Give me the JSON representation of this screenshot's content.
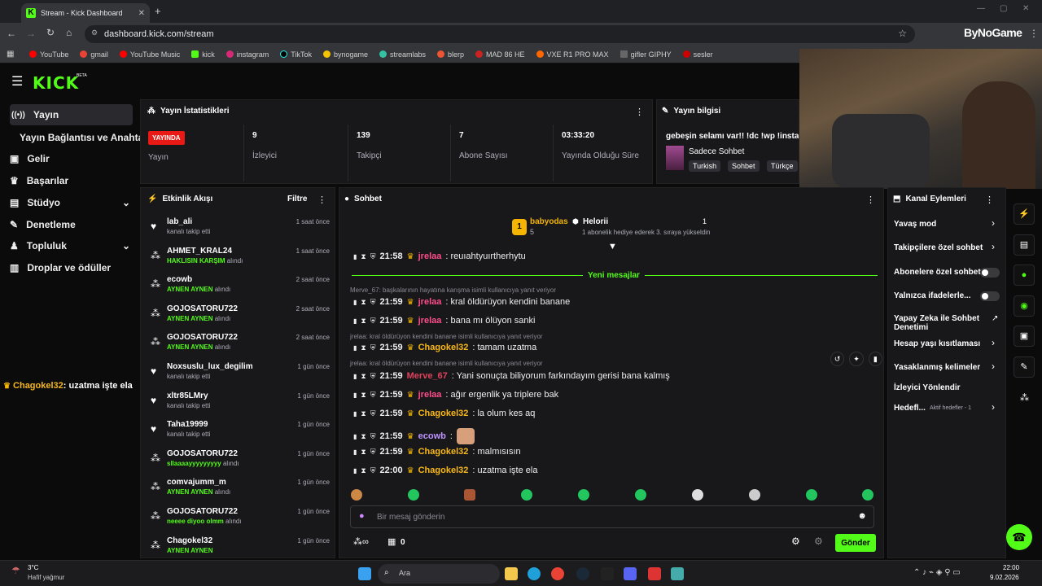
{
  "browser": {
    "tab_title": "Stream - Kick Dashboard",
    "url": "dashboard.kick.com/stream",
    "profile_label": "ByNoGame",
    "bookmarks": [
      "YouTube",
      "gmail",
      "YouTube Music",
      "kick",
      "instagram",
      "TikTok",
      "bynogame",
      "streamlabs",
      "blerp",
      "MAD 86 HE",
      "VXE R1 PRO MAX",
      "gifler GIPHY",
      "sesler"
    ]
  },
  "logo": "KICK",
  "logo_badge": "BETA",
  "sidebar": {
    "items": [
      {
        "label": "Yayın"
      },
      {
        "label": "Yayın Bağlantısı ve Anahtarı"
      },
      {
        "label": "Gelir"
      },
      {
        "label": "Başarılar"
      },
      {
        "label": "Stüdyo"
      },
      {
        "label": "Denetleme"
      },
      {
        "label": "Topluluk"
      },
      {
        "label": "Droplar ve ödüller"
      }
    ],
    "overlay_user": "Chagokel32",
    "overlay_text": ": uzatma işte ela"
  },
  "stats": {
    "title": "Yayın İstatistikleri",
    "live_badge": "YAYINDA",
    "live_label": "Yayın",
    "items": [
      {
        "value": "9",
        "label": "İzleyici"
      },
      {
        "value": "139",
        "label": "Takipçi"
      },
      {
        "value": "7",
        "label": "Abone Sayısı"
      },
      {
        "value": "03:33:20",
        "label": "Yayında Olduğu Süre"
      }
    ]
  },
  "stream_info": {
    "title": "Yayın bilgisi",
    "stream_title": "gebeşin selamı var!! !dc !wp !insta !b",
    "category": "Sadece Sohbet",
    "tags": [
      "Turkish",
      "Sohbet",
      "Türkçe"
    ]
  },
  "activity": {
    "title": "Etkinlik Akışı",
    "filter_label": "Filtre",
    "items": [
      {
        "name": "lab_ali",
        "sub": "kanalı takip etti",
        "time": "1 saat önce",
        "sub_green": false
      },
      {
        "name": "AHMET_KRAL24",
        "sub": "HAKLISIN KARŞIM",
        "sub2": "alındı",
        "time": "1 saat önce",
        "sub_green": true
      },
      {
        "name": "ecowb",
        "sub": "AYNEN AYNEN",
        "sub2": "alındı",
        "time": "2 saat önce",
        "sub_green": true
      },
      {
        "name": "GOJOSATORU722",
        "sub": "AYNEN AYNEN",
        "sub2": "alındı",
        "time": "2 saat önce",
        "sub_green": true
      },
      {
        "name": "GOJOSATORU722",
        "sub": "AYNEN AYNEN",
        "sub2": "alındı",
        "time": "2 saat önce",
        "sub_green": true
      },
      {
        "name": "Noxsuslu_lux_degilim",
        "sub": "kanalı takip etti",
        "time": "1 gün önce",
        "sub_green": false
      },
      {
        "name": "xltr85LMry",
        "sub": "kanalı takip etti",
        "time": "1 gün önce",
        "sub_green": false
      },
      {
        "name": "Taha19999",
        "sub": "kanalı takip etti",
        "time": "1 gün önce",
        "sub_green": false
      },
      {
        "name": "GOJOSATORU722",
        "sub": "sllaaaayyyyyyyyy",
        "sub2": "alındı",
        "time": "1 gün önce",
        "sub_green": true
      },
      {
        "name": "comvajumm_m",
        "sub": "AYNEN AYNEN",
        "sub2": "alındı",
        "time": "1 gün önce",
        "sub_green": true
      },
      {
        "name": "GOJOSATORU722",
        "sub": "neeee diyoo olmm",
        "sub2": "alındı",
        "time": "1 gün önce",
        "sub_green": true
      },
      {
        "name": "Chagokel32",
        "sub": "AYNEN AYNEN",
        "time": "1 gün önce",
        "sub_green": true
      }
    ]
  },
  "chat": {
    "title": "Sohbet",
    "leader_name": "babyodas",
    "leader_count": "5",
    "leader_rank": "1",
    "gifter_name": "Helorii",
    "gifter_count": "1",
    "gifter_note": "1 abonelik hediye ederek 3. sıraya yükseldin",
    "new_messages_label": "Yeni mesajlar",
    "messages": [
      {
        "time": "21:58",
        "user": "jrelaa",
        "color": "pink",
        "text": ": reuıahtyuırtherhytu"
      },
      {
        "reply": "Merve_67: başkalarının hayatına karışma isimli kullanıcıya yanıt veriyor"
      },
      {
        "time": "21:59",
        "user": "jrelaa",
        "color": "pink",
        "text": ": kral öldürüyon kendini banane"
      },
      {
        "time": "21:59",
        "user": "jrelaa",
        "color": "pink",
        "text": ": bana mı ölüyon sanki"
      },
      {
        "reply": "jrelaa: kral öldürüyon kendini banane isimli kullanıcıya yanıt veriyor"
      },
      {
        "time": "21:59",
        "user": "Chagokel32",
        "color": "orange",
        "text": ": tamam uzatma"
      },
      {
        "reply": "jrelaa: kral öldürüyon kendini banane isimli kullanıcıya yanıt veriyor"
      },
      {
        "time": "21:59",
        "user": "Merve_67",
        "color": "red",
        "text": ": Yani sonuçta biliyorum farkındayım gerisi bana kalmış"
      },
      {
        "time": "21:59",
        "user": "jrelaa",
        "color": "pink",
        "text": ": ağır ergenlik ya triplere bak"
      },
      {
        "time": "21:59",
        "user": "Chagokel32",
        "color": "orange",
        "text": ": la olum kes aq"
      },
      {
        "time": "21:59",
        "user": "ecowb",
        "color": "purple",
        "text": ":"
      },
      {
        "time": "21:59",
        "user": "Chagokel32",
        "color": "orange",
        "text": ": malmısısın"
      },
      {
        "time": "22:00",
        "user": "Chagokel32",
        "color": "orange",
        "text": ": uzatma işte ela"
      }
    ],
    "input_placeholder": "Bir mesaj gönderin",
    "points": "0",
    "send_label": "Gönder"
  },
  "channel_actions": {
    "title": "Kanal Eylemleri",
    "items": [
      {
        "label": "Yavaş mod",
        "kind": "chevron"
      },
      {
        "label": "Takipçilere özel sohbet",
        "kind": "chevron"
      },
      {
        "label": "Abonelere özel sohbet",
        "kind": "toggle"
      },
      {
        "label": "Yalnızca ifadelerle...",
        "kind": "toggle"
      },
      {
        "label": "Yapay Zeka ile Sohbet Denetimi",
        "kind": "external"
      },
      {
        "label": "Hesap yaşı kısıtlaması",
        "kind": "chevron"
      },
      {
        "label": "Yasaklanmış kelimeler",
        "kind": "chevron"
      },
      {
        "label": "İzleyici Yönlendir",
        "kind": "none"
      },
      {
        "label": "Hedefl...",
        "kind": "chevron",
        "badge": "Aktif hedefler - 1"
      }
    ]
  },
  "taskbar": {
    "weather_temp": "3°C",
    "weather_desc": "Hafif yağmur",
    "search_label": "Ara",
    "clock_time": "22:00",
    "clock_date": "9.02.2026"
  },
  "colors": {
    "brand": "#53fc18",
    "live": "#e91916"
  }
}
